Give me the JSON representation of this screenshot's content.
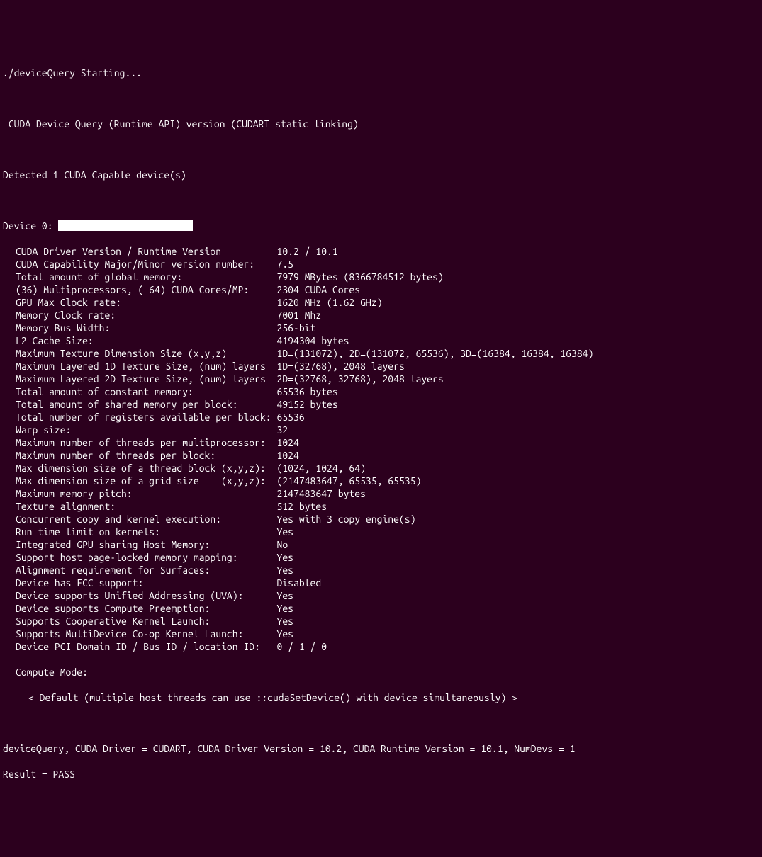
{
  "header": {
    "starting": "./deviceQuery Starting...",
    "title": " CUDA Device Query (Runtime API) version (CUDART static linking)",
    "detected": "Detected 1 CUDA Capable device(s)",
    "device_prefix": "Device 0: "
  },
  "props": [
    {
      "label": "CUDA Driver Version / Runtime Version",
      "value": "10.2 / 10.1"
    },
    {
      "label": "CUDA Capability Major/Minor version number:",
      "value": "7.5"
    },
    {
      "label": "Total amount of global memory:",
      "value": "7979 MBytes (8366784512 bytes)"
    },
    {
      "label": "(36) Multiprocessors, ( 64) CUDA Cores/MP:",
      "value": "2304 CUDA Cores"
    },
    {
      "label": "GPU Max Clock rate:",
      "value": "1620 MHz (1.62 GHz)"
    },
    {
      "label": "Memory Clock rate:",
      "value": "7001 Mhz"
    },
    {
      "label": "Memory Bus Width:",
      "value": "256-bit"
    },
    {
      "label": "L2 Cache Size:",
      "value": "4194304 bytes"
    },
    {
      "label": "Maximum Texture Dimension Size (x,y,z)",
      "value": "1D=(131072), 2D=(131072, 65536), 3D=(16384, 16384, 16384)"
    },
    {
      "label": "Maximum Layered 1D Texture Size, (num) layers",
      "value": "1D=(32768), 2048 layers"
    },
    {
      "label": "Maximum Layered 2D Texture Size, (num) layers",
      "value": "2D=(32768, 32768), 2048 layers"
    },
    {
      "label": "Total amount of constant memory:",
      "value": "65536 bytes"
    },
    {
      "label": "Total amount of shared memory per block:",
      "value": "49152 bytes"
    },
    {
      "label": "Total number of registers available per block:",
      "value": "65536"
    },
    {
      "label": "Warp size:",
      "value": "32"
    },
    {
      "label": "Maximum number of threads per multiprocessor:",
      "value": "1024"
    },
    {
      "label": "Maximum number of threads per block:",
      "value": "1024"
    },
    {
      "label": "Max dimension size of a thread block (x,y,z):",
      "value": "(1024, 1024, 64)"
    },
    {
      "label": "Max dimension size of a grid size    (x,y,z):",
      "value": "(2147483647, 65535, 65535)"
    },
    {
      "label": "Maximum memory pitch:",
      "value": "2147483647 bytes"
    },
    {
      "label": "Texture alignment:",
      "value": "512 bytes"
    },
    {
      "label": "Concurrent copy and kernel execution:",
      "value": "Yes with 3 copy engine(s)"
    },
    {
      "label": "Run time limit on kernels:",
      "value": "Yes"
    },
    {
      "label": "Integrated GPU sharing Host Memory:",
      "value": "No"
    },
    {
      "label": "Support host page-locked memory mapping:",
      "value": "Yes"
    },
    {
      "label": "Alignment requirement for Surfaces:",
      "value": "Yes"
    },
    {
      "label": "Device has ECC support:",
      "value": "Disabled"
    },
    {
      "label": "Device supports Unified Addressing (UVA):",
      "value": "Yes"
    },
    {
      "label": "Device supports Compute Preemption:",
      "value": "Yes"
    },
    {
      "label": "Supports Cooperative Kernel Launch:",
      "value": "Yes"
    },
    {
      "label": "Supports MultiDevice Co-op Kernel Launch:",
      "value": "Yes"
    },
    {
      "label": "Device PCI Domain ID / Bus ID / location ID:",
      "value": "0 / 1 / 0"
    }
  ],
  "compute_mode": {
    "label": "Compute Mode:",
    "value": "< Default (multiple host threads can use ::cudaSetDevice() with device simultaneously) >"
  },
  "footer": {
    "summary": "deviceQuery, CUDA Driver = CUDART, CUDA Driver Version = 10.2, CUDA Runtime Version = 10.1, NumDevs = 1",
    "result": "Result = PASS"
  }
}
